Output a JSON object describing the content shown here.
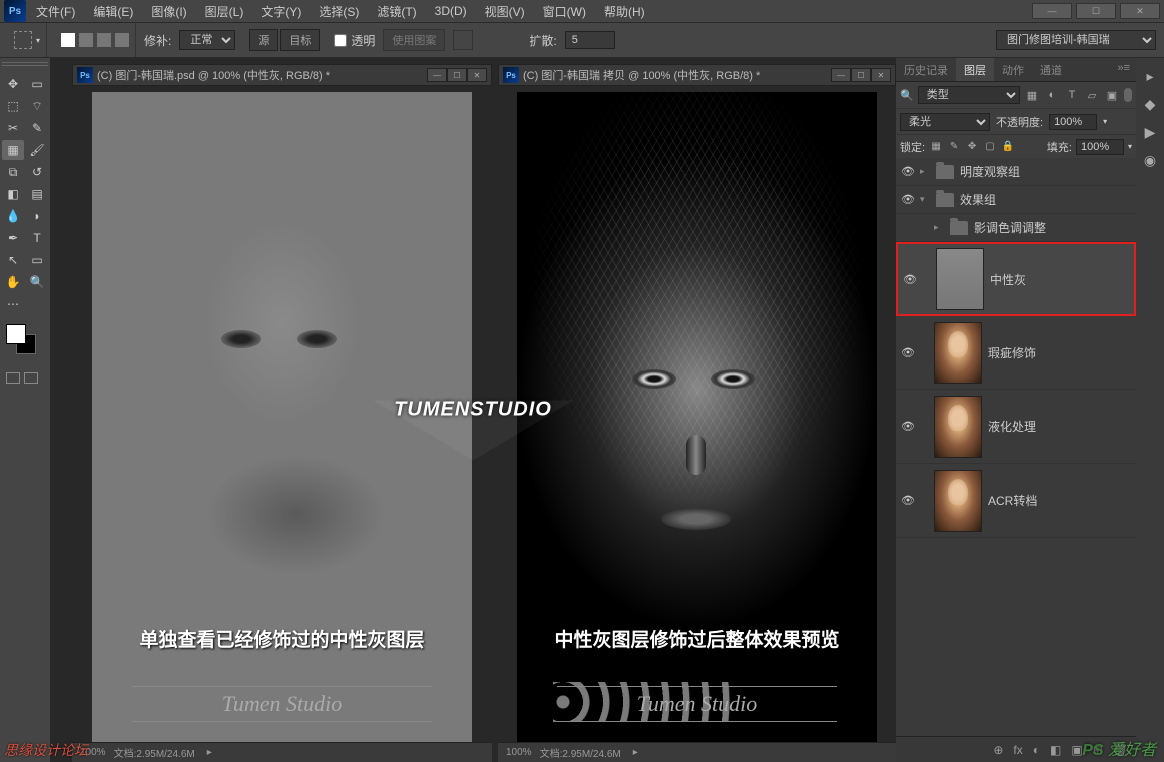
{
  "app": {
    "logo": "Ps"
  },
  "menu": [
    "文件(F)",
    "编辑(E)",
    "图像(I)",
    "图层(L)",
    "文字(Y)",
    "选择(S)",
    "滤镜(T)",
    "3D(D)",
    "视图(V)",
    "窗口(W)",
    "帮助(H)"
  ],
  "options": {
    "repair_label": "修补:",
    "repair_mode": "正常",
    "source": "源",
    "target": "目标",
    "transparent": "透明",
    "use_pattern": "使用图案",
    "diffuse_label": "扩散:",
    "diffuse_value": "5",
    "workspace_select": "图门修图培训-韩国瑞"
  },
  "doc1": {
    "title": "(C) 图门-韩国瑞.psd @ 100% (中性灰, RGB/8) *",
    "zoom": "100%",
    "status": "文档:2.95M/24.6M",
    "overlay": "单独查看已经修饰过的中性灰图层",
    "tumen": "Tumen Studio"
  },
  "doc2": {
    "title": "(C) 图门-韩国瑞 拷贝 @ 100% (中性灰, RGB/8) *",
    "zoom": "100%",
    "status": "文档:2.95M/24.6M",
    "overlay": "中性灰图层修饰过后整体效果预览",
    "tumen": "Tumen Studio"
  },
  "center_logo": "TUMENSTUDIO",
  "panels": {
    "tabs": [
      "历史记录",
      "图层",
      "动作",
      "通道"
    ],
    "active_tab": 1,
    "filter_label": "类型",
    "blend_mode": "柔光",
    "opacity_label": "不透明度:",
    "opacity_value": "100%",
    "lock_label": "锁定:",
    "fill_label": "填充:",
    "fill_value": "100%"
  },
  "layers": [
    {
      "type": "group",
      "name": "明度观察组",
      "indent": 0
    },
    {
      "type": "group",
      "name": "效果组",
      "indent": 0,
      "open": true
    },
    {
      "type": "group",
      "name": "影调色调调整",
      "indent": 1
    },
    {
      "type": "layer",
      "name": "中性灰",
      "thumb": "gray",
      "indent": 1,
      "selected": true
    },
    {
      "type": "layer",
      "name": "瑕疵修饰",
      "thumb": "portrait",
      "indent": 1
    },
    {
      "type": "layer",
      "name": "液化处理",
      "thumb": "portrait",
      "indent": 1
    },
    {
      "type": "layer",
      "name": "ACR转档",
      "thumb": "portrait",
      "indent": 1
    }
  ],
  "footer_icons": [
    "⊕",
    "fx",
    "◐",
    "◧",
    "▣",
    "⊞",
    "🗑"
  ],
  "watermark_left": "思缘设计论坛",
  "watermark_right": "PS 爱好者"
}
